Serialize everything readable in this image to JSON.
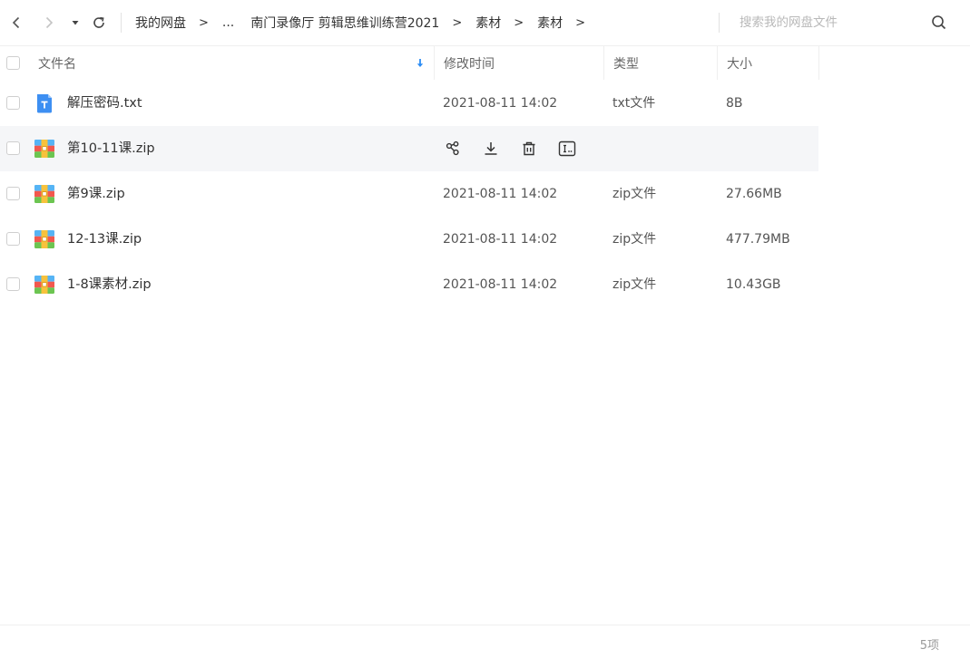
{
  "toolbar": {
    "breadcrumb": [
      "我的网盘",
      "...",
      "南门录像厅 剪辑思维训练营2021",
      "素材",
      "素材"
    ],
    "separator": ">",
    "search_placeholder": "搜索我的网盘文件"
  },
  "header": {
    "name": "文件名",
    "time": "修改时间",
    "type": "类型",
    "size": "大小"
  },
  "files": [
    {
      "name": "解压密码.txt",
      "time": "2021-08-11 14:02",
      "type": "txt文件",
      "size": "8B",
      "icon": "text-file-icon"
    },
    {
      "name": "第10-11课.zip",
      "time": "",
      "type": "",
      "size": "",
      "icon": "zip-file-icon",
      "hover": true
    },
    {
      "name": "第9课.zip",
      "time": "2021-08-11 14:02",
      "type": "zip文件",
      "size": "27.66MB",
      "icon": "zip-file-icon"
    },
    {
      "name": "12-13课.zip",
      "time": "2021-08-11 14:02",
      "type": "zip文件",
      "size": "477.79MB",
      "icon": "zip-file-icon"
    },
    {
      "name": "1-8课素材.zip",
      "time": "2021-08-11 14:02",
      "type": "zip文件",
      "size": "10.43GB",
      "icon": "zip-file-icon"
    }
  ],
  "footer": {
    "count": "5项"
  },
  "colors": {
    "accent": "#2c8cf4",
    "txt_icon": "#3d8ff2",
    "zip_blue": "#56b4f5",
    "zip_green": "#6cc551",
    "zip_red": "#f2584e",
    "zip_yellow": "#f7c23c"
  }
}
